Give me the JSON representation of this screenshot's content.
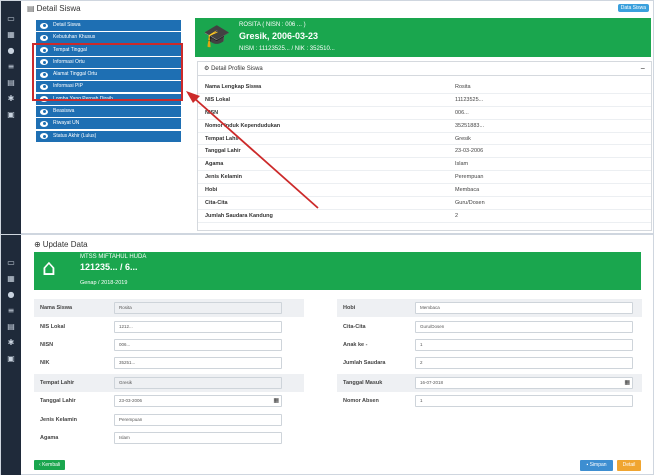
{
  "top": {
    "title": "Detail Siswa",
    "badge": "Data Siswa",
    "menu": [
      "Detail Siswa",
      "Kebutuhan Khusus",
      "Tempat Tinggal",
      "Informasi Ortu",
      "Alamat Tinggal Ortu",
      "Informasi PIP",
      "Lomba Yang Pernah Diraih",
      "Beasiswa",
      "Riwayat UN",
      "Status Akhir (Lulus)"
    ],
    "profile_header": {
      "name_line": "ROSITA ( NISN : 006 ... )",
      "birth_line": "Gresik, 2006-03-23",
      "ids_line": "NISM : 11123525... / NIK : 352510..."
    },
    "profile_panel": {
      "heading": "Detail Profile Siswa",
      "collapse": "−",
      "rows": [
        {
          "label": "Nama Lengkap Siswa",
          "value": "Rosita"
        },
        {
          "label": "NIS Lokal",
          "value": "11123525..."
        },
        {
          "label": "NISN",
          "value": "006..."
        },
        {
          "label": "Nomor Induk Kependudukan",
          "value": "35251883..."
        },
        {
          "label": "Tempat Lahir",
          "value": "Gresik"
        },
        {
          "label": "Tanggal Lahir",
          "value": "23-03-2006"
        },
        {
          "label": "Agama",
          "value": "Islam"
        },
        {
          "label": "Jenis Kelamin",
          "value": "Perempuan"
        },
        {
          "label": "Hobi",
          "value": "Membaca"
        },
        {
          "label": "Cita-Cita",
          "value": "Guru/Dosen"
        },
        {
          "label": "Jumlah Saudara Kandung",
          "value": "2"
        }
      ]
    }
  },
  "bottom": {
    "title": "Update Data",
    "school_header": {
      "name": "MTSS MIFTAHUL HUDA",
      "id_line": "121235... / 6...",
      "semester": "Genap / 2018-2019"
    },
    "left_fields": [
      {
        "label": "Nama Siswa",
        "value": "Rosita"
      },
      {
        "label": "NIS Lokal",
        "value": "1212..."
      },
      {
        "label": "NISN",
        "value": "006..."
      },
      {
        "label": "NIK",
        "value": "35251..."
      },
      {
        "label": "Tempat Lahir",
        "value": "Gresik"
      },
      {
        "label": "Tanggal Lahir",
        "value": "23-03-2006"
      },
      {
        "label": "Jenis Kelamin",
        "value": "Perempuan"
      },
      {
        "label": "Agama",
        "value": "Islam"
      }
    ],
    "right_fields": [
      {
        "label": "Hobi",
        "value": "Membaca"
      },
      {
        "label": "Cita-Cita",
        "value": "Guru/Dosen"
      },
      {
        "label": "Anak ke -",
        "value": "1"
      },
      {
        "label": "Jumlah Saudara",
        "value": "2"
      },
      {
        "label": "Tanggal Masuk",
        "value": "16-07-2018"
      },
      {
        "label": "Nomor Absen",
        "value": "1"
      }
    ],
    "buttons": {
      "back": "Kembali",
      "save": "Simpan",
      "detail": "Detail"
    }
  },
  "colors": {
    "sidebar": "#1f2a3a",
    "menu_blue": "#1e6fb3",
    "green": "#1aa64e",
    "highlight_red": "#cc2a2a",
    "save_blue": "#3d8ed1",
    "detail_orange": "#f0a530"
  },
  "icons": {
    "top_title": "user-icon",
    "profile_header": "graduation-cap-icon",
    "bottom_title": "plus-circle-icon",
    "school_header": "home-icon",
    "menu": "eye-icon",
    "date": "calendar-icon"
  }
}
